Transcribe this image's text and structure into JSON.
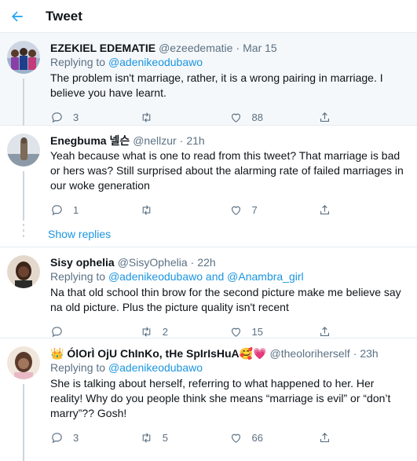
{
  "header": {
    "title": "Tweet",
    "back_icon": "arrow-left-icon",
    "accent": "#1da1f2"
  },
  "tweets": [
    {
      "name": "EZEKIEL EDEMATIE",
      "handle": "@ezeedematie",
      "dot": "·",
      "time": "Mar 15",
      "replying_prefix": "Replying to ",
      "mention1": "@adenikeodubawo",
      "text": "The problem isn't marriage, rather, it is a wrong pairing in marriage. I believe you have learnt.",
      "replies": "3",
      "retweets": "",
      "likes": "88"
    },
    {
      "name": "Enegbuma 넬슨",
      "handle": "@nellzur",
      "dot": "·",
      "time": "21h",
      "text": "Yeah because what is one to read from this tweet? That marriage is bad or hers was? Still surprised about the alarming rate of failed marriages in our woke generation",
      "replies": "1",
      "retweets": "",
      "likes": "7"
    },
    {
      "name": "Sisy ophelia",
      "handle": "@SisyOphelia",
      "dot": "·",
      "time": "22h",
      "replying_prefix": "Replying to ",
      "mention1": "@adenikeodubawo",
      "mention_and": " and ",
      "mention2": "@Anambra_girl",
      "text": "Na that old school thin brow for the second picture make me believe say na old picture. Plus the picture quality isn't recent",
      "replies": "",
      "retweets": "2",
      "likes": "15"
    },
    {
      "name": "👑 ÓlOrÌ OjU ChInKo, tHe SpIrIsHuA🥰💗",
      "handle": "@theoloriherself",
      "dot": "·",
      "time": "23h",
      "replying_prefix": "Replying to ",
      "mention1": "@adenikeodubawo",
      "text": "She is talking about herself, referring to what happened to her. Her reality! Why do you people think she means “marriage is evil” or “don’t marry”?? Gosh!",
      "replies": "3",
      "retweets": "5",
      "likes": "66"
    }
  ],
  "show_replies": "Show replies",
  "icons": [
    "reply-icon",
    "retweet-icon",
    "like-icon",
    "share-icon"
  ]
}
